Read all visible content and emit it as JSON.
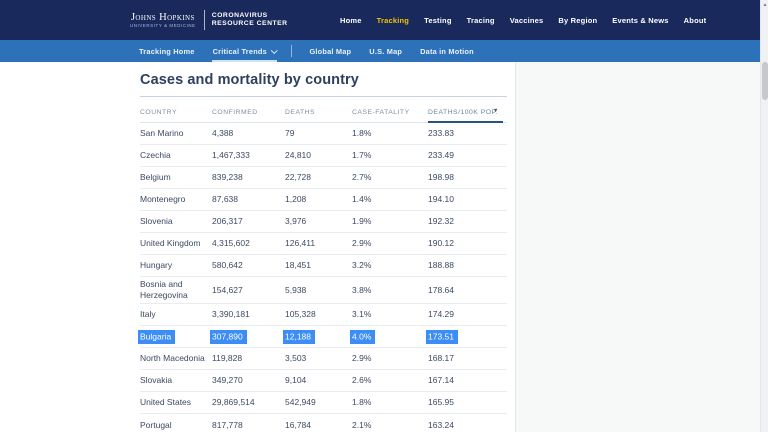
{
  "header": {
    "logo": {
      "brand_main": "Johns Hopkins",
      "brand_sub": "University & Medicine",
      "site_line1": "Coronavirus",
      "site_line2": "Resource Center"
    },
    "nav": [
      {
        "label": "Home",
        "active": false
      },
      {
        "label": "Tracking",
        "active": true
      },
      {
        "label": "Testing",
        "active": false
      },
      {
        "label": "Tracing",
        "active": false
      },
      {
        "label": "Vaccines",
        "active": false
      },
      {
        "label": "By Region",
        "active": false
      },
      {
        "label": "Events & News",
        "active": false
      },
      {
        "label": "About",
        "active": false
      }
    ]
  },
  "subnav": {
    "items": [
      {
        "label": "Tracking Home",
        "active": false
      },
      {
        "label": "Critical Trends",
        "active": true,
        "has_dropdown": true
      },
      {
        "label": "Global Map",
        "active": false
      },
      {
        "label": "U.S. Map",
        "active": false
      },
      {
        "label": "Data in Motion",
        "active": false
      }
    ]
  },
  "main": {
    "title": "Cases and mortality by country",
    "table": {
      "columns": [
        "Country",
        "Confirmed",
        "Deaths",
        "Case-Fatality",
        "Deaths/100k pop."
      ],
      "sorted_column": "Deaths/100k pop.",
      "sort_icon": "sort-dropdown-icon",
      "rows": [
        {
          "country": "San Marino",
          "confirmed": "4,388",
          "deaths": "79",
          "case_fatality": "1.8%",
          "deaths_100k": "233.83",
          "selected": false
        },
        {
          "country": "Czechia",
          "confirmed": "1,467,333",
          "deaths": "24,810",
          "case_fatality": "1.7%",
          "deaths_100k": "233.49",
          "selected": false
        },
        {
          "country": "Belgium",
          "confirmed": "839,238",
          "deaths": "22,728",
          "case_fatality": "2.7%",
          "deaths_100k": "198.98",
          "selected": false
        },
        {
          "country": "Montenegro",
          "confirmed": "87,638",
          "deaths": "1,208",
          "case_fatality": "1.4%",
          "deaths_100k": "194.10",
          "selected": false
        },
        {
          "country": "Slovenia",
          "confirmed": "206,317",
          "deaths": "3,976",
          "case_fatality": "1.9%",
          "deaths_100k": "192.32",
          "selected": false
        },
        {
          "country": "United Kingdom",
          "confirmed": "4,315,602",
          "deaths": "126,411",
          "case_fatality": "2.9%",
          "deaths_100k": "190.12",
          "selected": false
        },
        {
          "country": "Hungary",
          "confirmed": "580,642",
          "deaths": "18,451",
          "case_fatality": "3.2%",
          "deaths_100k": "188.88",
          "selected": false
        },
        {
          "country": "Bosnia and Herzegovina",
          "confirmed": "154,627",
          "deaths": "5,938",
          "case_fatality": "3.8%",
          "deaths_100k": "178.64",
          "selected": false
        },
        {
          "country": "Italy",
          "confirmed": "3,390,181",
          "deaths": "105,328",
          "case_fatality": "3.1%",
          "deaths_100k": "174.29",
          "selected": false
        },
        {
          "country": "Bulgaria",
          "confirmed": "307,890",
          "deaths": "12,188",
          "case_fatality": "4.0%",
          "deaths_100k": "173.51",
          "selected": true
        },
        {
          "country": "North Macedonia",
          "confirmed": "119,828",
          "deaths": "3,503",
          "case_fatality": "2.9%",
          "deaths_100k": "168.17",
          "selected": false
        },
        {
          "country": "Slovakia",
          "confirmed": "349,270",
          "deaths": "9,104",
          "case_fatality": "2.6%",
          "deaths_100k": "167.14",
          "selected": false
        },
        {
          "country": "United States",
          "confirmed": "29,869,514",
          "deaths": "542,949",
          "case_fatality": "1.8%",
          "deaths_100k": "165.95",
          "selected": false
        },
        {
          "country": "Portugal",
          "confirmed": "817,778",
          "deaths": "16,784",
          "case_fatality": "2.1%",
          "deaths_100k": "163.24",
          "selected": false
        }
      ]
    }
  },
  "colors": {
    "header_navy": "#19295c",
    "subnav_blue": "#2d71b8",
    "accent_yellow": "#f1c400",
    "selection_blue": "#3d8df6",
    "sort_underline": "#2b5084"
  }
}
